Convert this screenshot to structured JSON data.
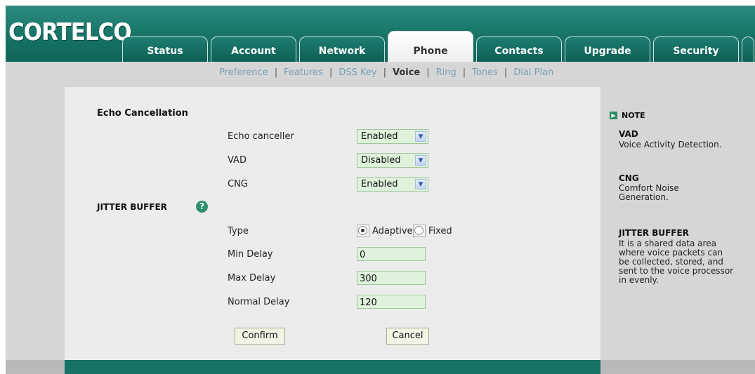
{
  "logo": "CORTELCO",
  "tabs": [
    {
      "label": "Status"
    },
    {
      "label": "Account"
    },
    {
      "label": "Network"
    },
    {
      "label": "Phone"
    },
    {
      "label": "Contacts"
    },
    {
      "label": "Upgrade"
    },
    {
      "label": "Security"
    }
  ],
  "subnav": [
    "Preference",
    "Features",
    "DSS Key",
    "Voice",
    "Ring",
    "Tones",
    "Dial Plan"
  ],
  "echo": {
    "heading": "Echo Cancellation",
    "echo_canceller": {
      "label": "Echo canceller",
      "value": "Enabled"
    },
    "vad": {
      "label": "VAD",
      "value": "Disabled"
    },
    "cng": {
      "label": "CNG",
      "value": "Enabled"
    }
  },
  "jitter": {
    "heading": "JITTER BUFFER",
    "type_label": "Type",
    "adaptive": "Adaptive",
    "fixed": "Fixed",
    "selected": "Adaptive",
    "min_delay": {
      "label": "Min Delay",
      "value": "0"
    },
    "max_delay": {
      "label": "Max Delay",
      "value": "300"
    },
    "normal_delay": {
      "label": "Normal Delay",
      "value": "120"
    }
  },
  "buttons": {
    "confirm": "Confirm",
    "cancel": "Cancel"
  },
  "note": {
    "header": "NOTE",
    "vad_title": "VAD",
    "vad_text": "Voice Activity Detection.",
    "cng_title": "CNG",
    "cng_text": "Comfort Noise Generation.",
    "jb_title": "JITTER BUFFER",
    "jb_text": "It is a shared data area where voice packets can be collected, stored, and sent to the voice processor in evenly."
  },
  "colors": {
    "brand": "#177366",
    "field": "#dff3dc"
  }
}
